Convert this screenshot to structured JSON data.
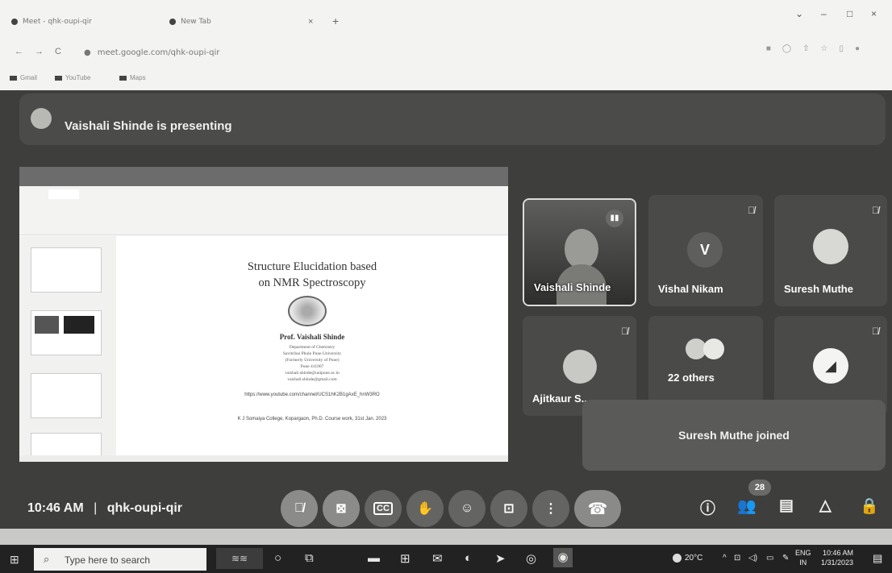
{
  "browser": {
    "tabs": [
      {
        "label": "Meet - qhk-oupi-qir"
      },
      {
        "label": "New Tab"
      }
    ],
    "new_tab_symbol": "+",
    "close_symbol": "×",
    "url": "meet.google.com/qhk-oupi-qir",
    "bookmarks": [
      "Gmail",
      "YouTube",
      "Maps"
    ],
    "window_controls": [
      "⌄",
      "–",
      "□",
      "×"
    ]
  },
  "meet": {
    "presenting_banner": "Vaishali Shinde is presenting",
    "slide": {
      "title_line1": "Structure Elucidation based",
      "title_line2": "on NMR Spectroscopy",
      "presenter_name": "Prof. Vaishali Shinde",
      "dept_lines": [
        "Department of Chemistry",
        "Savitribai Phule Pune University",
        "(Formerly University of Pune)",
        "Pune 411007",
        "vaishali.shinde@unipune.ac.in",
        "vaishali.shinde@gmail.com"
      ],
      "link": "https://www.youtube.com/channel/UCS1hK2B1gAxE_hnW3RO",
      "footer": "K J Somaiya College, Kopargaon, Ph.D. Course work, 31st Jan. 2023"
    },
    "participants": [
      {
        "name": "Vaishali Shinde",
        "muted": false
      },
      {
        "name": "Vishal Nikam",
        "initial": "V",
        "muted": true
      },
      {
        "name": "Suresh Muthe",
        "muted": true
      },
      {
        "name": "Ajitkaur S...",
        "muted": true
      },
      {
        "name": "22 others",
        "muted": false
      },
      {
        "name": "",
        "muted": true
      }
    ],
    "toast": "Suresh Muthe joined",
    "clock": "10:46 AM",
    "separator": "|",
    "meeting_code": "qhk-oupi-qir",
    "participant_count": "28"
  },
  "taskbar": {
    "search_placeholder": "Type here to search",
    "weather": "20°C",
    "lang_line1": "ENG",
    "lang_line2": "IN",
    "time": "10:46 AM",
    "date": "1/31/2023"
  }
}
